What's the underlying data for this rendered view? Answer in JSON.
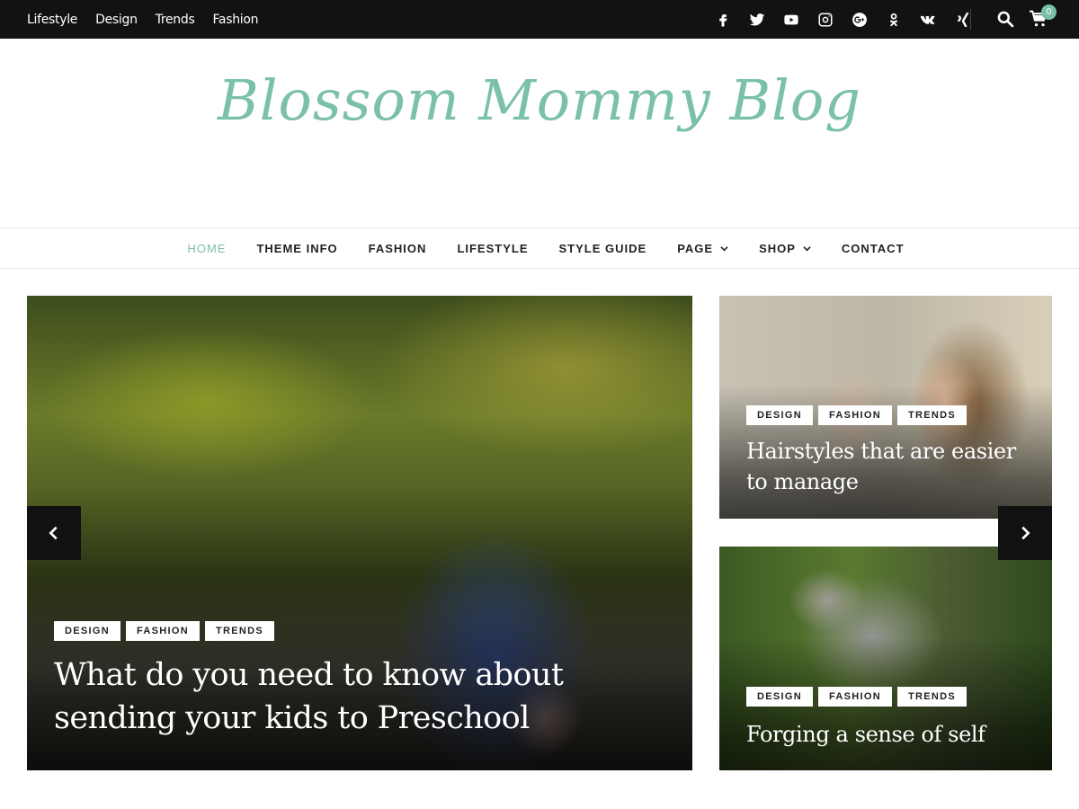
{
  "topbar": {
    "links": [
      "Lifestyle",
      "Design",
      "Trends",
      "Fashion"
    ],
    "social_icons": [
      "facebook-icon",
      "twitter-icon",
      "youtube-icon",
      "instagram-icon",
      "google-plus-icon",
      "odnoklassniki-icon",
      "vk-icon",
      "xing-icon"
    ],
    "cart_count": "0"
  },
  "site": {
    "title": "Blossom Mommy Blog",
    "accent_color": "#7bc0a9"
  },
  "nav": {
    "items": [
      {
        "label": "HOME",
        "active": true
      },
      {
        "label": "THEME INFO"
      },
      {
        "label": "FASHION"
      },
      {
        "label": "LIFESTYLE"
      },
      {
        "label": "STYLE GUIDE"
      },
      {
        "label": "PAGE",
        "has_dropdown": true
      },
      {
        "label": "SHOP",
        "has_dropdown": true
      },
      {
        "label": "CONTACT"
      }
    ]
  },
  "slider": {
    "main": {
      "categories": [
        "DESIGN",
        "FASHION",
        "TRENDS"
      ],
      "title": "What do you need to know about sending your kids to Preschool"
    },
    "side1": {
      "categories": [
        "DESIGN",
        "FASHION",
        "TRENDS"
      ],
      "title": "Hairstyles that are easier to manage"
    },
    "side2": {
      "categories": [
        "DESIGN",
        "FASHION",
        "TRENDS"
      ],
      "title": "Forging a sense of self"
    }
  }
}
